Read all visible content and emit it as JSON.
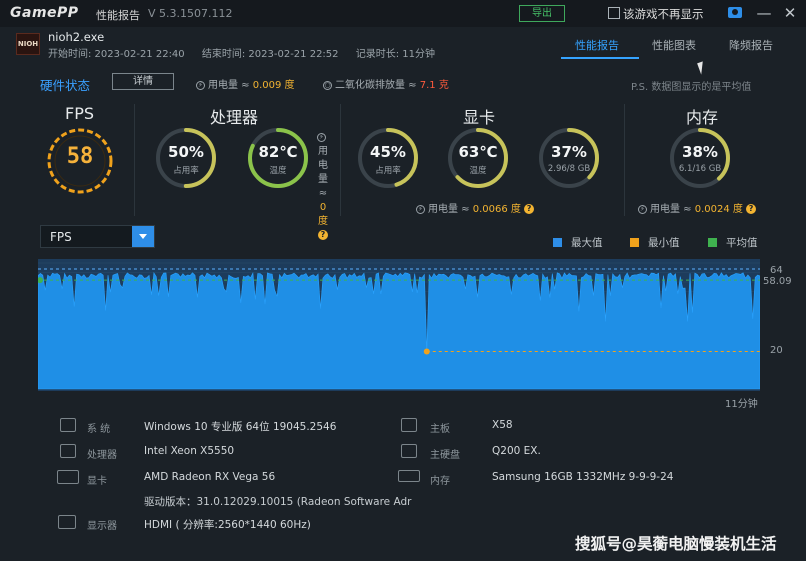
{
  "titlebar": {
    "logo": "GamePP",
    "title": "性能报告",
    "version": "V 5.3.1507.112",
    "export_label": "导出",
    "hide_label": "该游戏不再显示",
    "minimize": "—",
    "close": "✕"
  },
  "game": {
    "icon_text": "NIOH",
    "exe": "nioh2.exe",
    "start": "开始时间: 2023-02-21 22:40",
    "end": "结束时间: 2023-02-21 22:52",
    "duration": "记录时长: 11分钟"
  },
  "tabs": [
    {
      "label": "性能报告",
      "active": true
    },
    {
      "label": "性能图表",
      "active": false
    },
    {
      "label": "降频报告",
      "active": false
    }
  ],
  "hardware": {
    "title": "硬件状态",
    "detail_button": "详情",
    "power_label": "用电量 ≈ ",
    "power_value": "0.009 度",
    "co2_label": "二氧化碳排放量 ≈ ",
    "co2_value": "7.1 克",
    "note": "P.S. 数据图显示的是平均值"
  },
  "sections": {
    "fps": {
      "title": "FPS",
      "value": "58"
    },
    "cpu": {
      "title": "处理器",
      "usage": {
        "value": "50%",
        "label": "占用率",
        "fraction": 0.5
      },
      "temp": {
        "value": "82℃",
        "label": "温度",
        "fraction": 0.82
      },
      "power_label": "用电量 ≈",
      "power_value": "0 度"
    },
    "gpu": {
      "title": "显卡",
      "usage": {
        "value": "45%",
        "label": "占用率",
        "fraction": 0.45
      },
      "temp": {
        "value": "63℃",
        "label": "温度",
        "fraction": 0.63
      },
      "vram": {
        "value": "37%",
        "label": "2.96/8 GB",
        "fraction": 0.37
      },
      "power_label": "用电量 ≈ ",
      "power_value": "0.0066 度"
    },
    "mem": {
      "title": "内存",
      "usage": {
        "value": "38%",
        "label": "6.1/16 GB",
        "fraction": 0.38
      },
      "power_label": "用电量 ≈ ",
      "power_value": "0.0024 度"
    }
  },
  "chart_controls": {
    "selected_metric": "FPS",
    "legend": [
      {
        "label": "最大值",
        "color": "#2e8ee8"
      },
      {
        "label": "最小值",
        "color": "#f0a21c"
      },
      {
        "label": "平均值",
        "color": "#3fb24f"
      }
    ]
  },
  "chart_data": {
    "type": "area",
    "metric": "FPS",
    "max": 64,
    "min": 20,
    "avg": 58.09,
    "ylim": [
      0,
      64
    ],
    "x_end_label": "11分钟",
    "labels": {
      "max": "64",
      "avg": "58.09",
      "min": "20"
    },
    "min_point_x_fraction": 0.54
  },
  "system_info": {
    "os_key": "系 统",
    "os": "Windows 10 专业版 64位 19045.2546",
    "cpu_key": "处理器",
    "cpu": "Intel Xeon X5550",
    "gpu_key": "显卡",
    "gpu": "AMD Radeon RX Vega 56",
    "driver": "驱动版本：31.0.12029.10015 (Radeon Software Adr",
    "display_key": "显示器",
    "display": "HDMI ( 分辨率:2560*1440 60Hz)",
    "board_key": "主板",
    "board": "X58",
    "disk_key": "主硬盘",
    "disk": "Q200 EX.",
    "ram_key": "内存",
    "ram": "Samsung 16GB 1332MHz 9-9-9-24"
  },
  "watermark": "搜狐号@昊蘅电脑慢装机生活"
}
